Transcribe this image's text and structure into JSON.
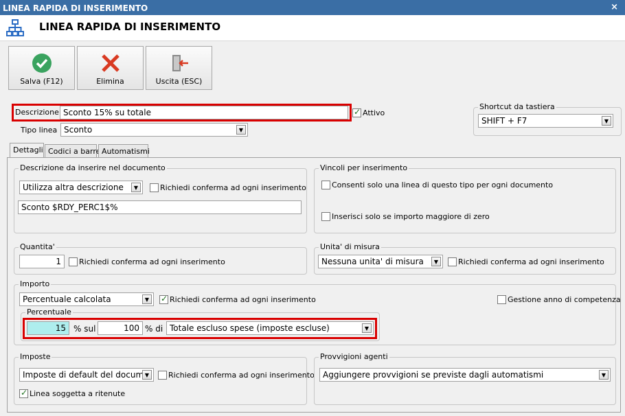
{
  "window": {
    "title": "LINEA RAPIDA DI INSERIMENTO",
    "close": "×"
  },
  "header": {
    "title": "LINEA RAPIDA DI INSERIMENTO"
  },
  "toolbar": {
    "save_label": "Salva (F12)",
    "delete_label": "Elimina",
    "exit_label": "Uscita (ESC)"
  },
  "form": {
    "descrizione_label": "Descrizione :",
    "descrizione_value": "Sconto 15% su totale",
    "attivo_label": "Attivo",
    "tipo_linea_label": "Tipo linea :",
    "tipo_linea_value": "Sconto",
    "shortcut_title": "Shortcut da tastiera",
    "shortcut_value": "SHIFT + F7"
  },
  "tabs": [
    "Dettagli",
    "Codici a barre",
    "Automatismi"
  ],
  "descrizione_group": {
    "title": "Descrizione da inserire nel documento",
    "combo_value": "Utilizza altra descrizione",
    "confirm_label": "Richiedi conferma ad ogni inserimento",
    "text_value": "Sconto $RDY_PERC1$%"
  },
  "vincoli_group": {
    "title": "Vincoli per inserimento",
    "opt1": "Consenti solo una linea di questo tipo per ogni documento",
    "opt2": "Inserisci solo se importo maggiore di zero"
  },
  "quantita_group": {
    "title": "Quantita'",
    "value": "1",
    "confirm_label": "Richiedi conferma ad ogni inserimento"
  },
  "unita_group": {
    "title": "Unita' di misura",
    "combo_value": "Nessuna unita' di misura",
    "confirm_label": "Richiedi conferma ad ogni inserimento"
  },
  "importo_group": {
    "title": "Importo",
    "combo_value": "Percentuale calcolata",
    "confirm_label": "Richiedi conferma ad ogni inserimento",
    "gestione_label": "Gestione anno di competenza",
    "percentuale_title": "Percentuale",
    "perc_value": "15",
    "perc_sul_label": "% sul",
    "base_value": "100",
    "perc_di_label": "% di",
    "base_combo": "Totale escluso spese (imposte escluse)"
  },
  "imposte_group": {
    "title": "Imposte",
    "combo_value": "Imposte di default del docume",
    "confirm_label": "Richiedi conferma ad ogni inserimento",
    "ritenute_label": "Linea soggetta a ritenute"
  },
  "provvigioni_group": {
    "title": "Provvigioni agenti",
    "combo_value": "Aggiungere provvigioni se previste dagli automatismi"
  }
}
